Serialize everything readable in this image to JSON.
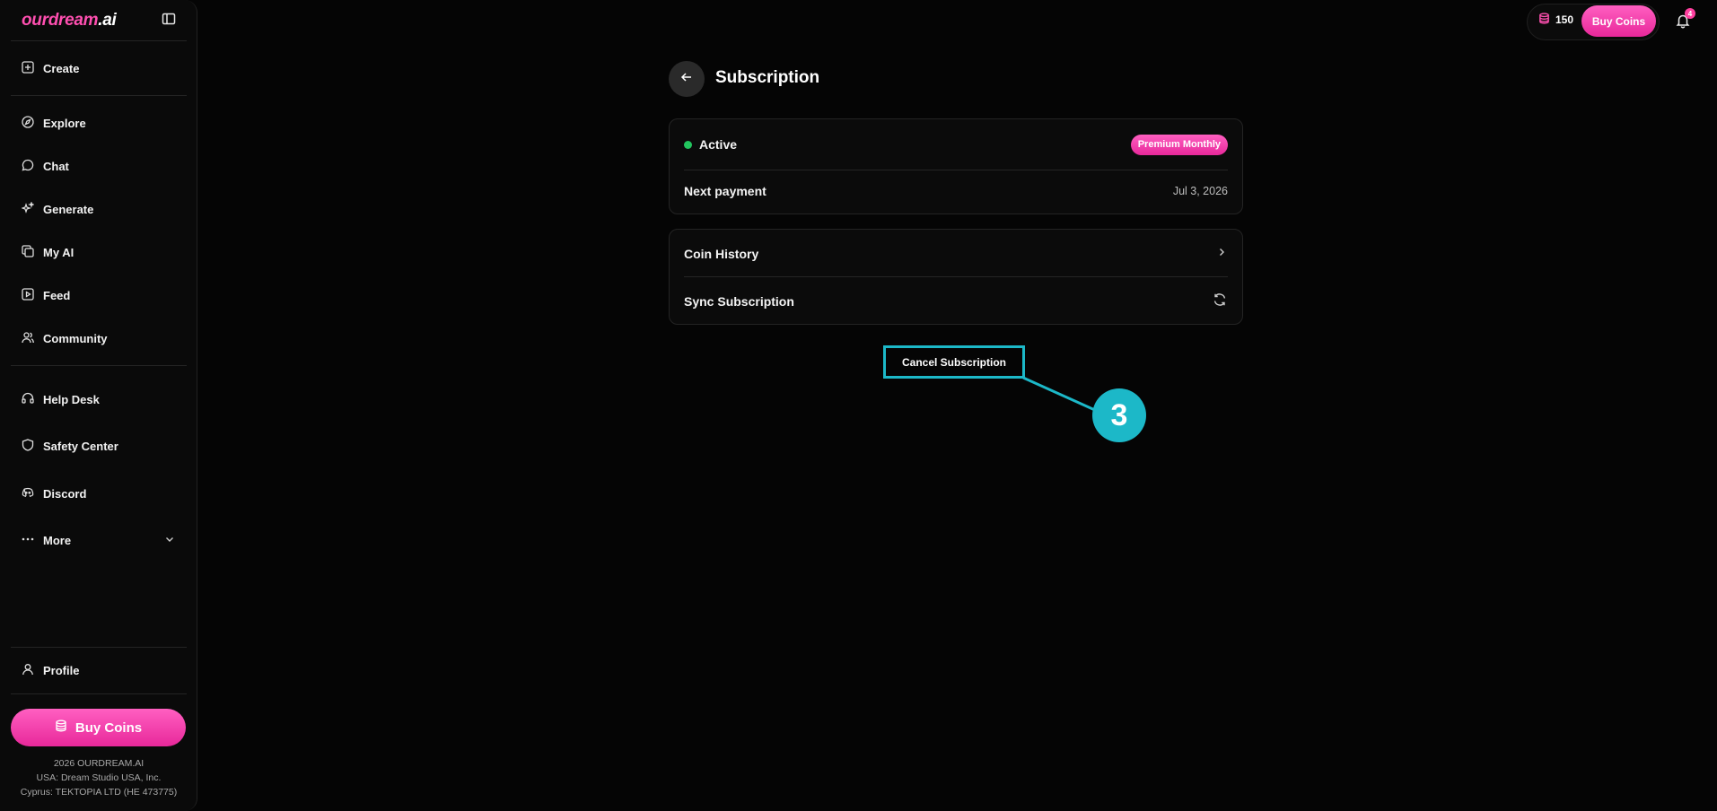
{
  "brand": {
    "logo_main": "ourdream",
    "logo_suffix": ".ai"
  },
  "sidebar": {
    "items": [
      {
        "label": "Create",
        "icon": "plus-square-icon"
      },
      {
        "label": "Explore",
        "icon": "compass-icon"
      },
      {
        "label": "Chat",
        "icon": "chat-bubble-icon"
      },
      {
        "label": "Generate",
        "icon": "sparkles-icon"
      },
      {
        "label": "My AI",
        "icon": "copy-icon"
      },
      {
        "label": "Feed",
        "icon": "play-square-icon"
      },
      {
        "label": "Community",
        "icon": "users-icon"
      },
      {
        "label": "Help Desk",
        "icon": "headset-icon"
      },
      {
        "label": "Safety Center",
        "icon": "shield-icon"
      },
      {
        "label": "Discord",
        "icon": "discord-icon"
      },
      {
        "label": "More",
        "icon": "dots-icon"
      },
      {
        "label": "Profile",
        "icon": "user-icon"
      }
    ],
    "buy_coins": "Buy Coins",
    "footer": [
      "2026 OURDREAM.AI",
      "USA: Dream Studio USA, Inc.",
      "Cyprus: TEKTOPIA LTD (HE 473775)"
    ]
  },
  "topbar": {
    "coins": "150",
    "buy_coins": "Buy Coins",
    "notification_count": "4"
  },
  "main": {
    "title": "Subscription",
    "status": "Active",
    "plan": "Premium Monthly",
    "next_payment_label": "Next payment",
    "next_payment_date": "Jul 3, 2026",
    "coin_history": "Coin History",
    "sync_subscription": "Sync Subscription",
    "cancel_subscription": "Cancel Subscription"
  },
  "annotation": {
    "step": "3"
  },
  "colors": {
    "accent": "#ff4fb0",
    "status_active": "#22c55e",
    "callout": "#1cb8c8"
  }
}
